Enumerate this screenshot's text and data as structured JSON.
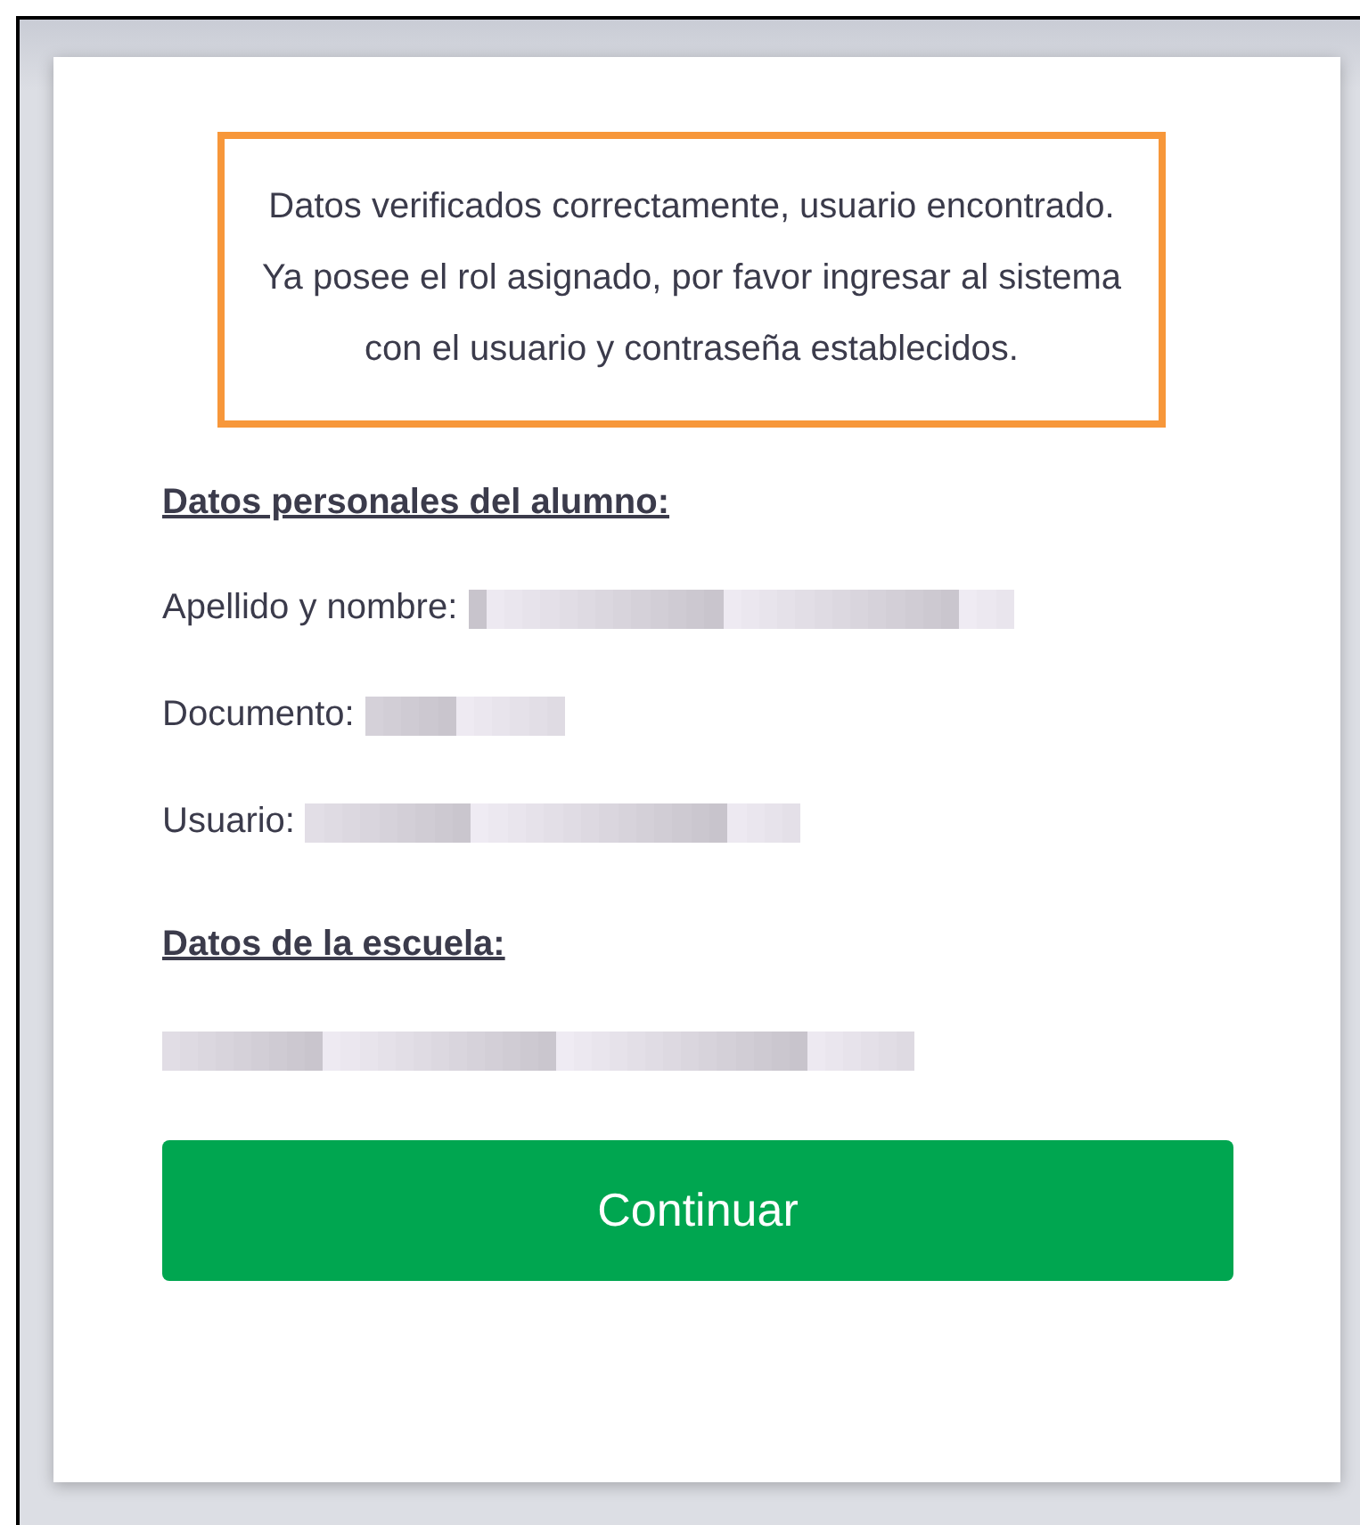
{
  "notice": {
    "message": "Datos verificados correctamente, usuario encontrado. Ya posee el rol asignado, por favor ingresar al sistema con el usuario y contraseña establecidos."
  },
  "student": {
    "heading": "Datos personales del alumno:",
    "fields": [
      {
        "label": "Apellido y nombre:",
        "redacted": true
      },
      {
        "label": "Documento:",
        "redacted": true
      },
      {
        "label": "Usuario:",
        "redacted": true
      }
    ]
  },
  "school": {
    "heading": "Datos de la escuela:",
    "redacted": true
  },
  "buttons": [
    {
      "label": "Continuar",
      "kind": "primary"
    }
  ]
}
